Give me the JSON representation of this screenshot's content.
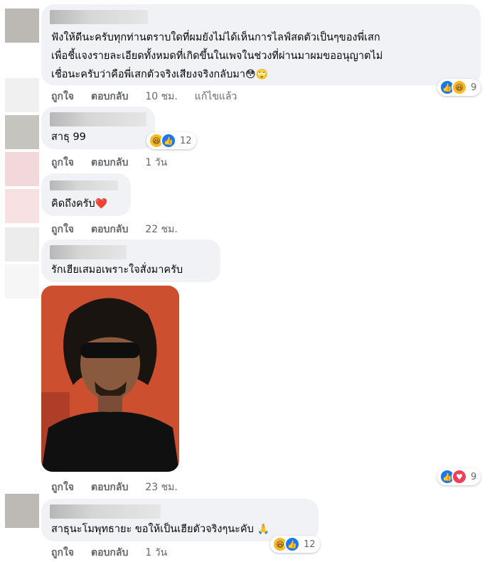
{
  "actions": {
    "like": "ถูกใจ",
    "reply": "ตอบกลับ"
  },
  "comments": [
    {
      "lines": [
        "ฟังให้ดีนะครับทุกท่านตราบใดที่ผมยังไม่ได้เห็นการไลฟ์สดตัวเป็นๆของพี่เสก",
        "เพื่อชี้แจงรายละเอียดทั้งหมดที่เกิดขึ้นในเพจในช่วงที่ผ่านมาผมขออนุญาตไม่",
        "เชื่อนะครับว่าคือพี่เสกตัวจริงเสียงจริงกลับมา"
      ],
      "emoji": "😳🙄",
      "time": "10 ชม.",
      "edited": "แก้ไขแล้ว",
      "reaction_count": "9",
      "reaction_icons": [
        "like-icon",
        "haha-icon"
      ]
    },
    {
      "text": "สาธุ 99",
      "time": "1 วัน",
      "reaction_count": "12",
      "reaction_icons": [
        "haha-icon",
        "like-icon"
      ]
    },
    {
      "text": "คิดถึงครับ",
      "emoji": "❤️",
      "time": "22 ชม."
    },
    {
      "text": "รักเฮียเสมอเพราะใจสั่งมาครับ",
      "time": "23 ชม.",
      "reaction_count": "9",
      "reaction_icons": [
        "like-icon",
        "love-icon"
      ]
    },
    {
      "text": "สาธุนะโมพุทธายะ ขอให้เป็นเฮียตัวจริงๆนะคับ",
      "emoji": "🙏",
      "time": "1 วัน",
      "reaction_count": "12",
      "reaction_icons": [
        "haha-icon",
        "like-icon"
      ]
    }
  ],
  "colors": {
    "bubble": "#f0f2f5",
    "meta": "#65676b",
    "like": "#1877f2",
    "love": "#f33e58",
    "haha": "#f7b928"
  }
}
